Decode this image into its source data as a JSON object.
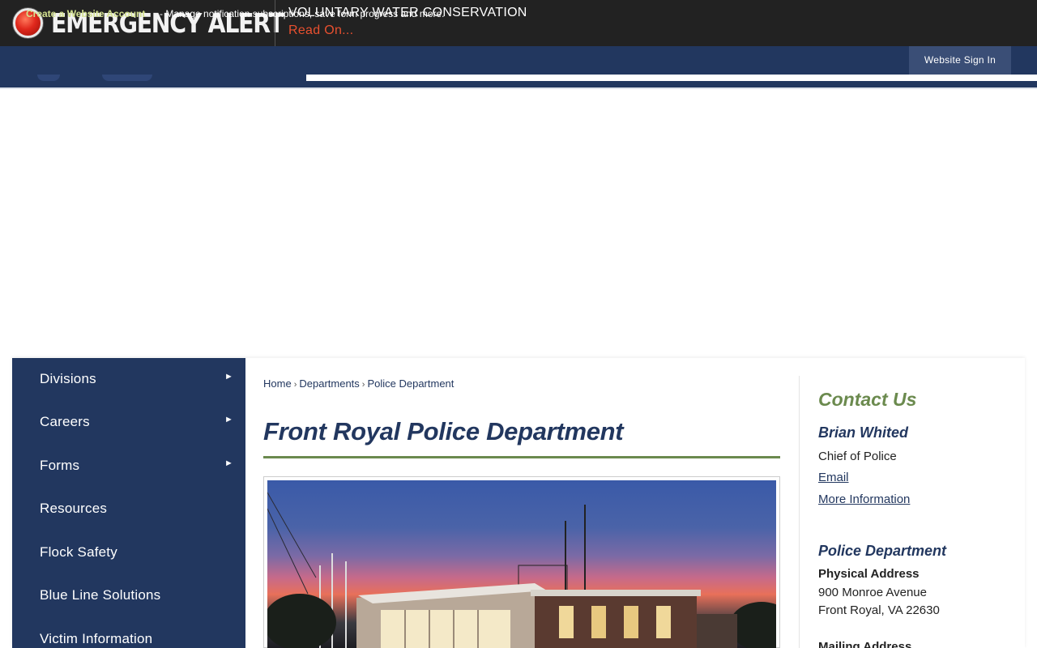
{
  "alert": {
    "icon": "alert-circle-icon",
    "title": "EMERGENCY ALERT",
    "headline": "VOLUNTARY WATER CONSERVATION",
    "read_on": "Read On..."
  },
  "account_bar": {
    "create_link": "Create a Website Account",
    "description": " - Manage notification subscriptions, save form progress and more.",
    "sign_in": "Website Sign In"
  },
  "sidebar": {
    "items": [
      {
        "label": "Divisions",
        "has_submenu": true
      },
      {
        "label": "Careers",
        "has_submenu": true
      },
      {
        "label": "Forms",
        "has_submenu": true
      },
      {
        "label": "Resources",
        "has_submenu": false
      },
      {
        "label": "Flock Safety",
        "has_submenu": false
      },
      {
        "label": "Blue Line Solutions",
        "has_submenu": false
      },
      {
        "label": "Victim Information",
        "has_submenu": false
      }
    ],
    "arrow_glyph": "►"
  },
  "breadcrumb": {
    "items": [
      "Home",
      "Departments",
      "Police Department"
    ],
    "separator": "›"
  },
  "main": {
    "title": "Front Royal Police Department"
  },
  "contact": {
    "heading": "Contact Us",
    "name": "Brian Whited",
    "role": "Chief of Police",
    "email_link": "Email",
    "more_link": "More Information",
    "department": "Police Department",
    "physical_label": "Physical Address",
    "address_line1": "900 Monroe Avenue",
    "address_line2": "Front Royal, VA 22630",
    "mailing_label": "Mailing Address"
  },
  "colors": {
    "navy": "#22375f",
    "olive": "#6b8a4e",
    "alert_red": "#e8502f",
    "account_link": "#d3e18f"
  }
}
